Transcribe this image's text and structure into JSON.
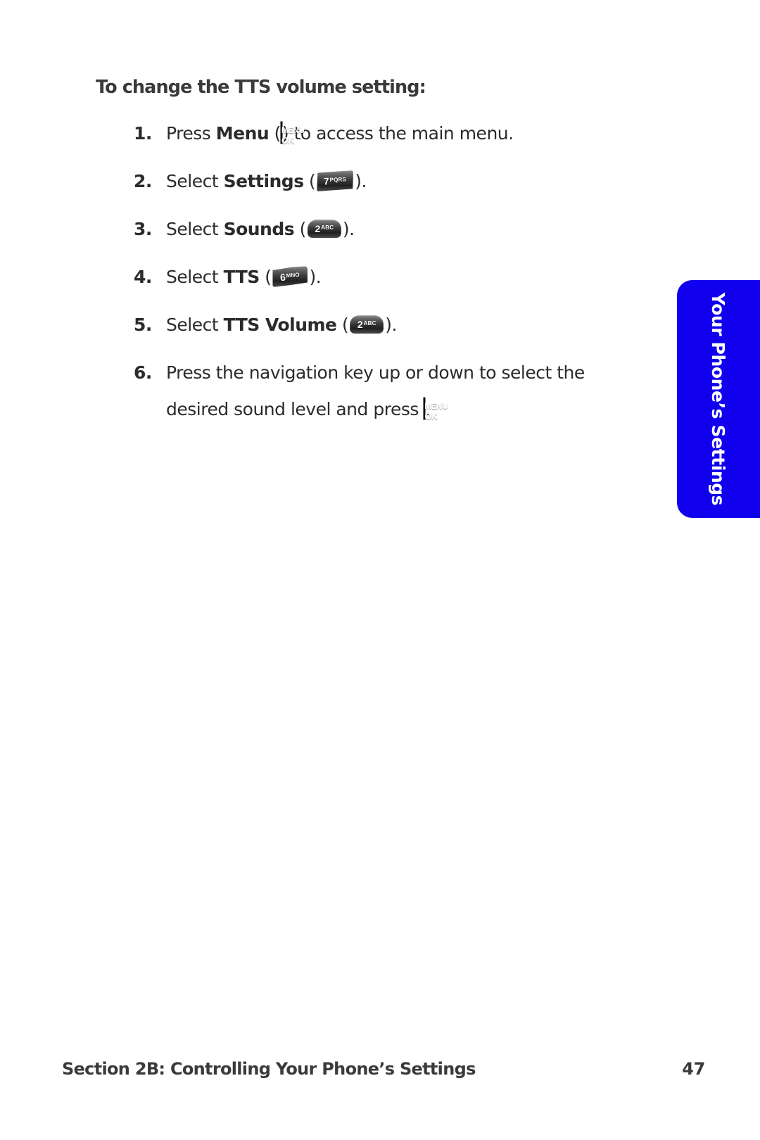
{
  "document": {
    "heading": "To change the TTS volume setting:",
    "steps": [
      {
        "number": "1.",
        "lines": [
          [
            {
              "t": "text",
              "v": "Press "
            },
            {
              "t": "bold",
              "v": "Menu"
            },
            {
              "t": "text",
              "v": " ("
            },
            {
              "t": "key",
              "key": "menu"
            },
            {
              "t": "text",
              "v": ") to access the main menu."
            }
          ]
        ]
      },
      {
        "number": "2.",
        "lines": [
          [
            {
              "t": "text",
              "v": "Select "
            },
            {
              "t": "bold",
              "v": "Settings"
            },
            {
              "t": "text",
              "v": " ("
            },
            {
              "t": "key",
              "key": "7"
            },
            {
              "t": "text",
              "v": ")."
            }
          ]
        ]
      },
      {
        "number": "3.",
        "lines": [
          [
            {
              "t": "text",
              "v": "Select "
            },
            {
              "t": "bold",
              "v": "Sounds"
            },
            {
              "t": "text",
              "v": " ("
            },
            {
              "t": "key",
              "key": "2"
            },
            {
              "t": "text",
              "v": ")."
            }
          ]
        ]
      },
      {
        "number": "4.",
        "lines": [
          [
            {
              "t": "text",
              "v": "Select "
            },
            {
              "t": "bold",
              "v": "TTS"
            },
            {
              "t": "text",
              "v": " ("
            },
            {
              "t": "key",
              "key": "6"
            },
            {
              "t": "text",
              "v": ")."
            }
          ]
        ]
      },
      {
        "number": "5.",
        "lines": [
          [
            {
              "t": "text",
              "v": "Select "
            },
            {
              "t": "bold",
              "v": "TTS Volume"
            },
            {
              "t": "text",
              "v": " ("
            },
            {
              "t": "key",
              "key": "2"
            },
            {
              "t": "text",
              "v": ")."
            }
          ]
        ]
      },
      {
        "number": "6.",
        "lines": [
          [
            {
              "t": "text",
              "v": "Press the navigation key up or down to select the"
            }
          ],
          [
            {
              "t": "text",
              "v": "desired sound level and press "
            },
            {
              "t": "key",
              "key": "menu"
            },
            {
              "t": "text",
              "v": "."
            }
          ]
        ]
      }
    ]
  },
  "keys": {
    "menu": {
      "name": "menu-ok-key-icon",
      "line1": "MENU",
      "line2": "OK",
      "color": "#0a35cf"
    },
    "7": {
      "name": "keypad-7-pqrs-icon",
      "digit": "7",
      "letters": "PQRS",
      "color": "#3b3b3b"
    },
    "2": {
      "name": "keypad-2-abc-icon",
      "digit": "2",
      "letters": "ABC",
      "color": "#3b3b3b"
    },
    "6": {
      "name": "keypad-6-mno-icon",
      "digit": "6",
      "letters": "MNO",
      "color": "#3b3b3b"
    }
  },
  "side_tab": {
    "label": "Your Phone’s Settings",
    "color": "#1000ee"
  },
  "footer": {
    "title": "Section 2B: Controlling Your Phone’s Settings",
    "page_number": "47"
  }
}
